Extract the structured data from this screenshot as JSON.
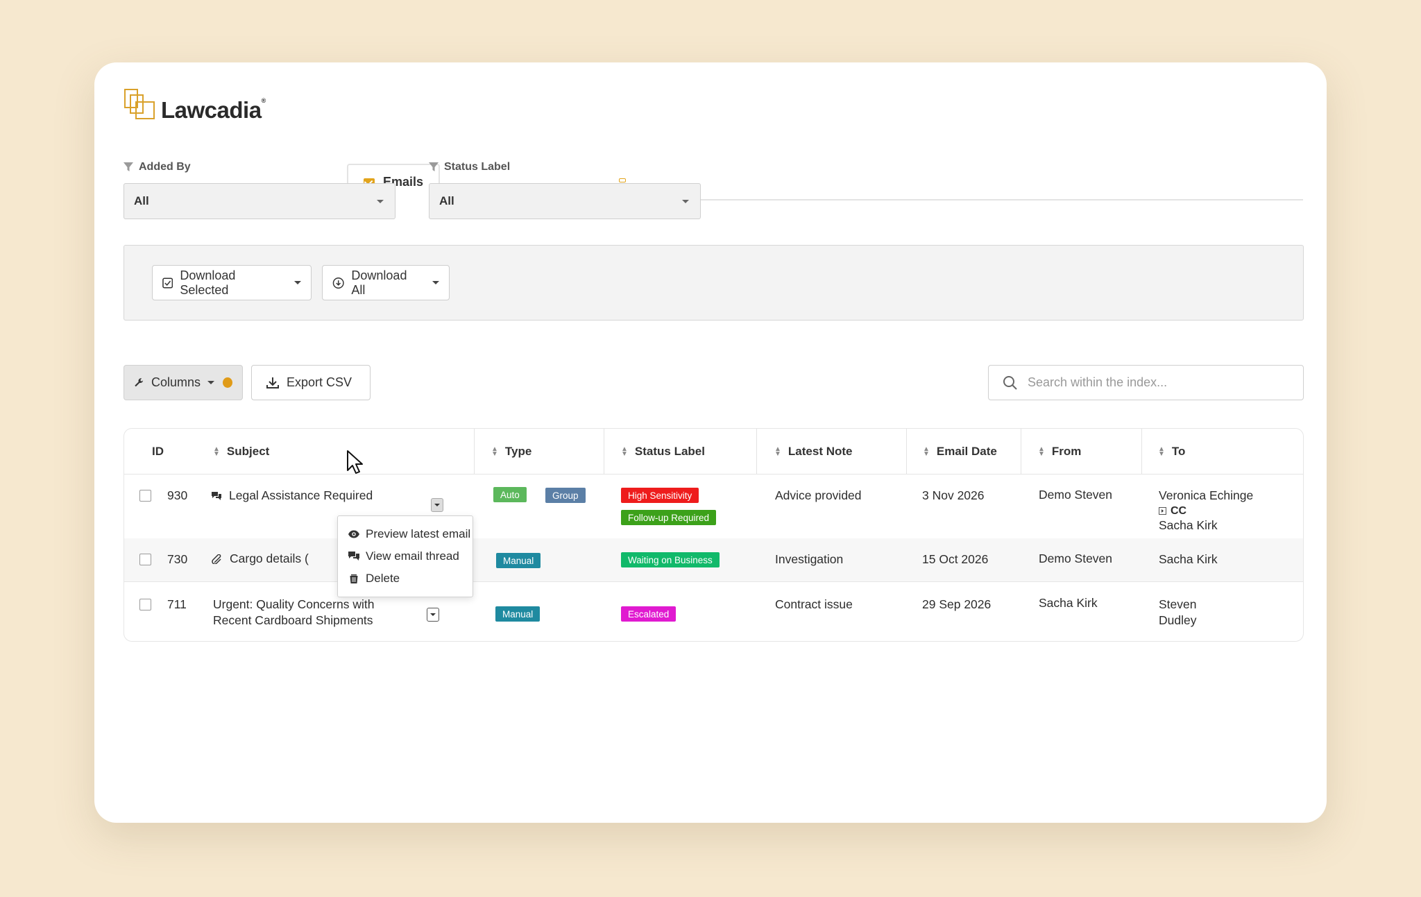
{
  "app": {
    "name": "Lawcadia",
    "reg_mark": "®"
  },
  "tabs": [
    {
      "label": "Emails",
      "icon": "envelope-icon",
      "active": true
    }
  ],
  "filters": {
    "added_by": {
      "label": "Added By",
      "value": "All"
    },
    "status_label": {
      "label": "Status Label",
      "value": "All"
    }
  },
  "download": {
    "selected_label": "Download Selected",
    "all_label": "Download All"
  },
  "toolbar": {
    "columns_label": "Columns",
    "export_label": "Export CSV",
    "search_placeholder": "Search within the index..."
  },
  "table": {
    "headers": [
      "ID",
      "Subject",
      "Type",
      "Status Label",
      "Latest Note",
      "Email Date",
      "From",
      "To"
    ],
    "rows": [
      {
        "id": "930",
        "subject": "Legal Assistance Required",
        "subject_icon": "chat-bubbles-icon",
        "types": [
          "Auto",
          "Group"
        ],
        "statuses": [
          "High Sensitivity",
          "Follow-up Required"
        ],
        "note": "Advice provided",
        "date": "3 Nov 2026",
        "from": "Demo Steven",
        "to": "Veronica Echinge",
        "cc_label": "CC",
        "cc": "Sacha Kirk"
      },
      {
        "id": "730",
        "subject": "Cargo details (",
        "subject_icon": "paperclip-icon",
        "types": [
          "Manual"
        ],
        "statuses": [
          "Waiting on Business"
        ],
        "note": "Investigation",
        "date": "15 Oct 2026",
        "from": "Demo Steven",
        "to": "Sacha Kirk"
      },
      {
        "id": "711",
        "subject_line1": "Urgent: Quality Concerns with",
        "subject_line2": "Recent Cardboard Shipments",
        "types": [
          "Manual"
        ],
        "statuses": [
          "Escalated"
        ],
        "note": "Contract issue",
        "date": "29 Sep 2026",
        "from": "Sacha Kirk",
        "to_line1": "Steven",
        "to_line2": "Dudley"
      }
    ]
  },
  "row_menu": {
    "items": [
      {
        "label": "Preview latest email",
        "icon": "eye-icon"
      },
      {
        "label": "View email thread",
        "icon": "chat-bubbles-icon"
      },
      {
        "label": "Delete",
        "icon": "trash-icon"
      }
    ]
  },
  "colors": {
    "accent": "#e2a41c",
    "tag_auto": "#5cb85c",
    "tag_group": "#5b7fa6",
    "tag_manual": "#1f8aa0",
    "status_high": "#ee1c1c",
    "status_followup": "#3ca11a",
    "status_waiting": "#11b96a",
    "status_escalated": "#e01ad0"
  }
}
